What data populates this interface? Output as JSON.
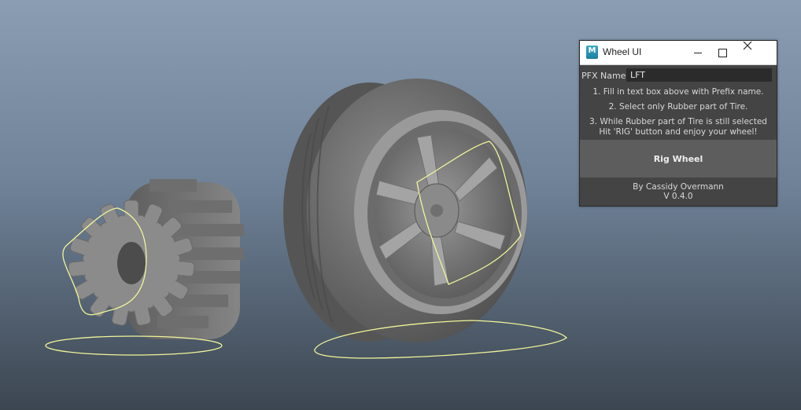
{
  "window": {
    "title": "Wheel UI",
    "icon": "maya-app-icon",
    "icon_letter": "M"
  },
  "form": {
    "pfx_label": "PFX Name:",
    "pfx_value": "LFT"
  },
  "instructions": {
    "line1": "1. Fill in text box above with Prefix name.",
    "line2": "2. Select only Rubber part of Tire.",
    "line3a": "3. While Rubber part of Tire is still selected",
    "line3b": "Hit 'RIG' button and enjoy your wheel!"
  },
  "button": {
    "label": "Rig Wheel"
  },
  "footer": {
    "author": "By Cassidy Overmann",
    "version": "V 0.4.0"
  },
  "colors": {
    "viewport_top": "#8a9db3",
    "viewport_bottom": "#3c4651",
    "curve": "#f0f59a",
    "panel": "#444444"
  }
}
